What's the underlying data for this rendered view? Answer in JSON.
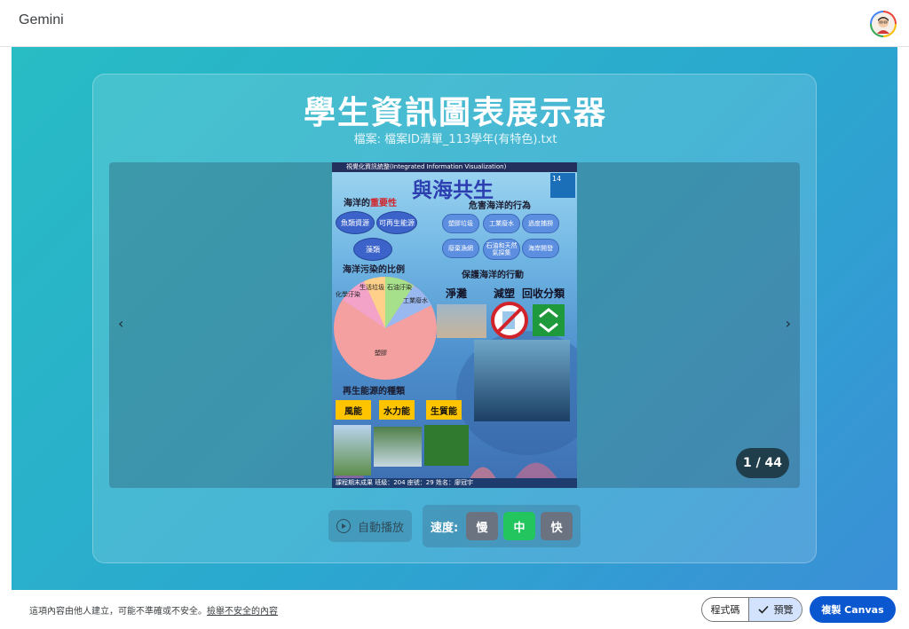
{
  "header": {
    "app_title": "Gemini"
  },
  "card": {
    "title": "學生資訊圖表展示器",
    "file_label": "檔案: 檔案ID清單_113學年(有特色).txt"
  },
  "viewer": {
    "prev_icon": "‹",
    "next_icon": "›",
    "counter": "1 / 44",
    "poster": {
      "header_text": "視覺化資訊統整(Integrated Information Visualization)",
      "title": "與海共生",
      "sdg_number": "14",
      "importance_heading_prefix": "海洋的",
      "importance_heading_highlight": "重要性",
      "importance_items": [
        "魚類資源",
        "可再生能源",
        "藻類"
      ],
      "threats_heading": "危害海洋的行為",
      "threat_items": [
        "塑膠垃圾",
        "工業廢水",
        "過度捕撈",
        "廢棄漁網",
        "石油和天然氣採集",
        "海岸開發"
      ],
      "pollution_heading": "海洋污染的比例",
      "pie_labels": [
        "生活垃圾",
        "石油汙染",
        "化學汙染",
        "工業廢水",
        "塑膠"
      ],
      "actions_heading": "保護海洋的行動",
      "actions": [
        "淨灘",
        "減塑",
        "回收分類"
      ],
      "energy_heading": "再生能源的種類",
      "energy_types": [
        "風能",
        "水力能",
        "生質能"
      ],
      "footer_text": "課程期末成果  班級：204  座號：29  姓名：廖冠宇"
    }
  },
  "controls": {
    "autoplay_label": "自動播放",
    "speed_label": "速度:",
    "speeds": [
      "慢",
      "中",
      "快"
    ],
    "active_speed": "中"
  },
  "footer": {
    "disclaimer": "這項內容由他人建立，可能不準確或不安全。",
    "report_link": "檢舉不安全的內容",
    "code_tab": "程式碼",
    "preview_tab": "預覽",
    "copy_button": "複製 Canvas"
  },
  "colors": {
    "canvas_gradient_start": "#28bcc4",
    "canvas_gradient_end": "#3b8fd6",
    "active_speed": "#22c55e",
    "inactive_speed": "#6b7280",
    "copy_button": "#0b57d0",
    "counter_bg": "#1f3d4b"
  }
}
